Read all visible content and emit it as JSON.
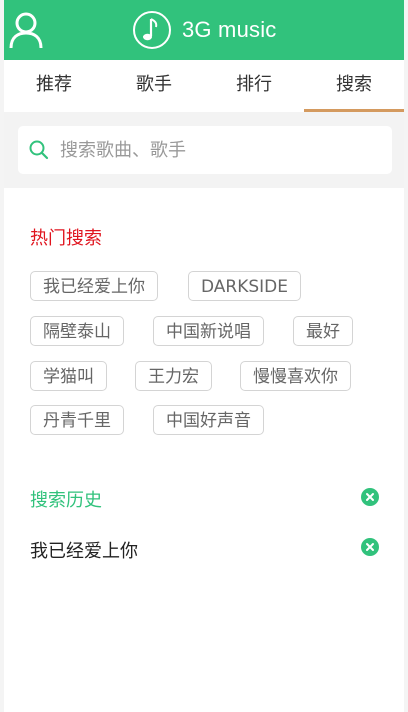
{
  "header": {
    "brand": "3G music",
    "user_icon": "user-icon",
    "logo_icon": "music-note-icon",
    "color": "#31c27c"
  },
  "tabs": [
    {
      "label": "推荐",
      "active": false
    },
    {
      "label": "歌手",
      "active": false
    },
    {
      "label": "排行",
      "active": false
    },
    {
      "label": "搜索",
      "active": true
    }
  ],
  "search": {
    "placeholder": "搜索歌曲、歌手",
    "value": "",
    "icon": "search-icon"
  },
  "hot": {
    "title": "热门搜索",
    "title_color": "#e0141e",
    "tags": [
      "我已经爱上你",
      "DARKSIDE",
      "隔壁泰山",
      "中国新说唱",
      "最好",
      "学猫叫",
      "王力宏",
      "慢慢喜欢你",
      "丹青千里",
      "中国好声音"
    ]
  },
  "history": {
    "title": "搜索历史",
    "clear_icon": "close-circle-icon",
    "items": [
      {
        "label": "我已经爱上你",
        "delete_icon": "close-circle-icon"
      }
    ]
  },
  "tab_active_color": "#d49a5f"
}
